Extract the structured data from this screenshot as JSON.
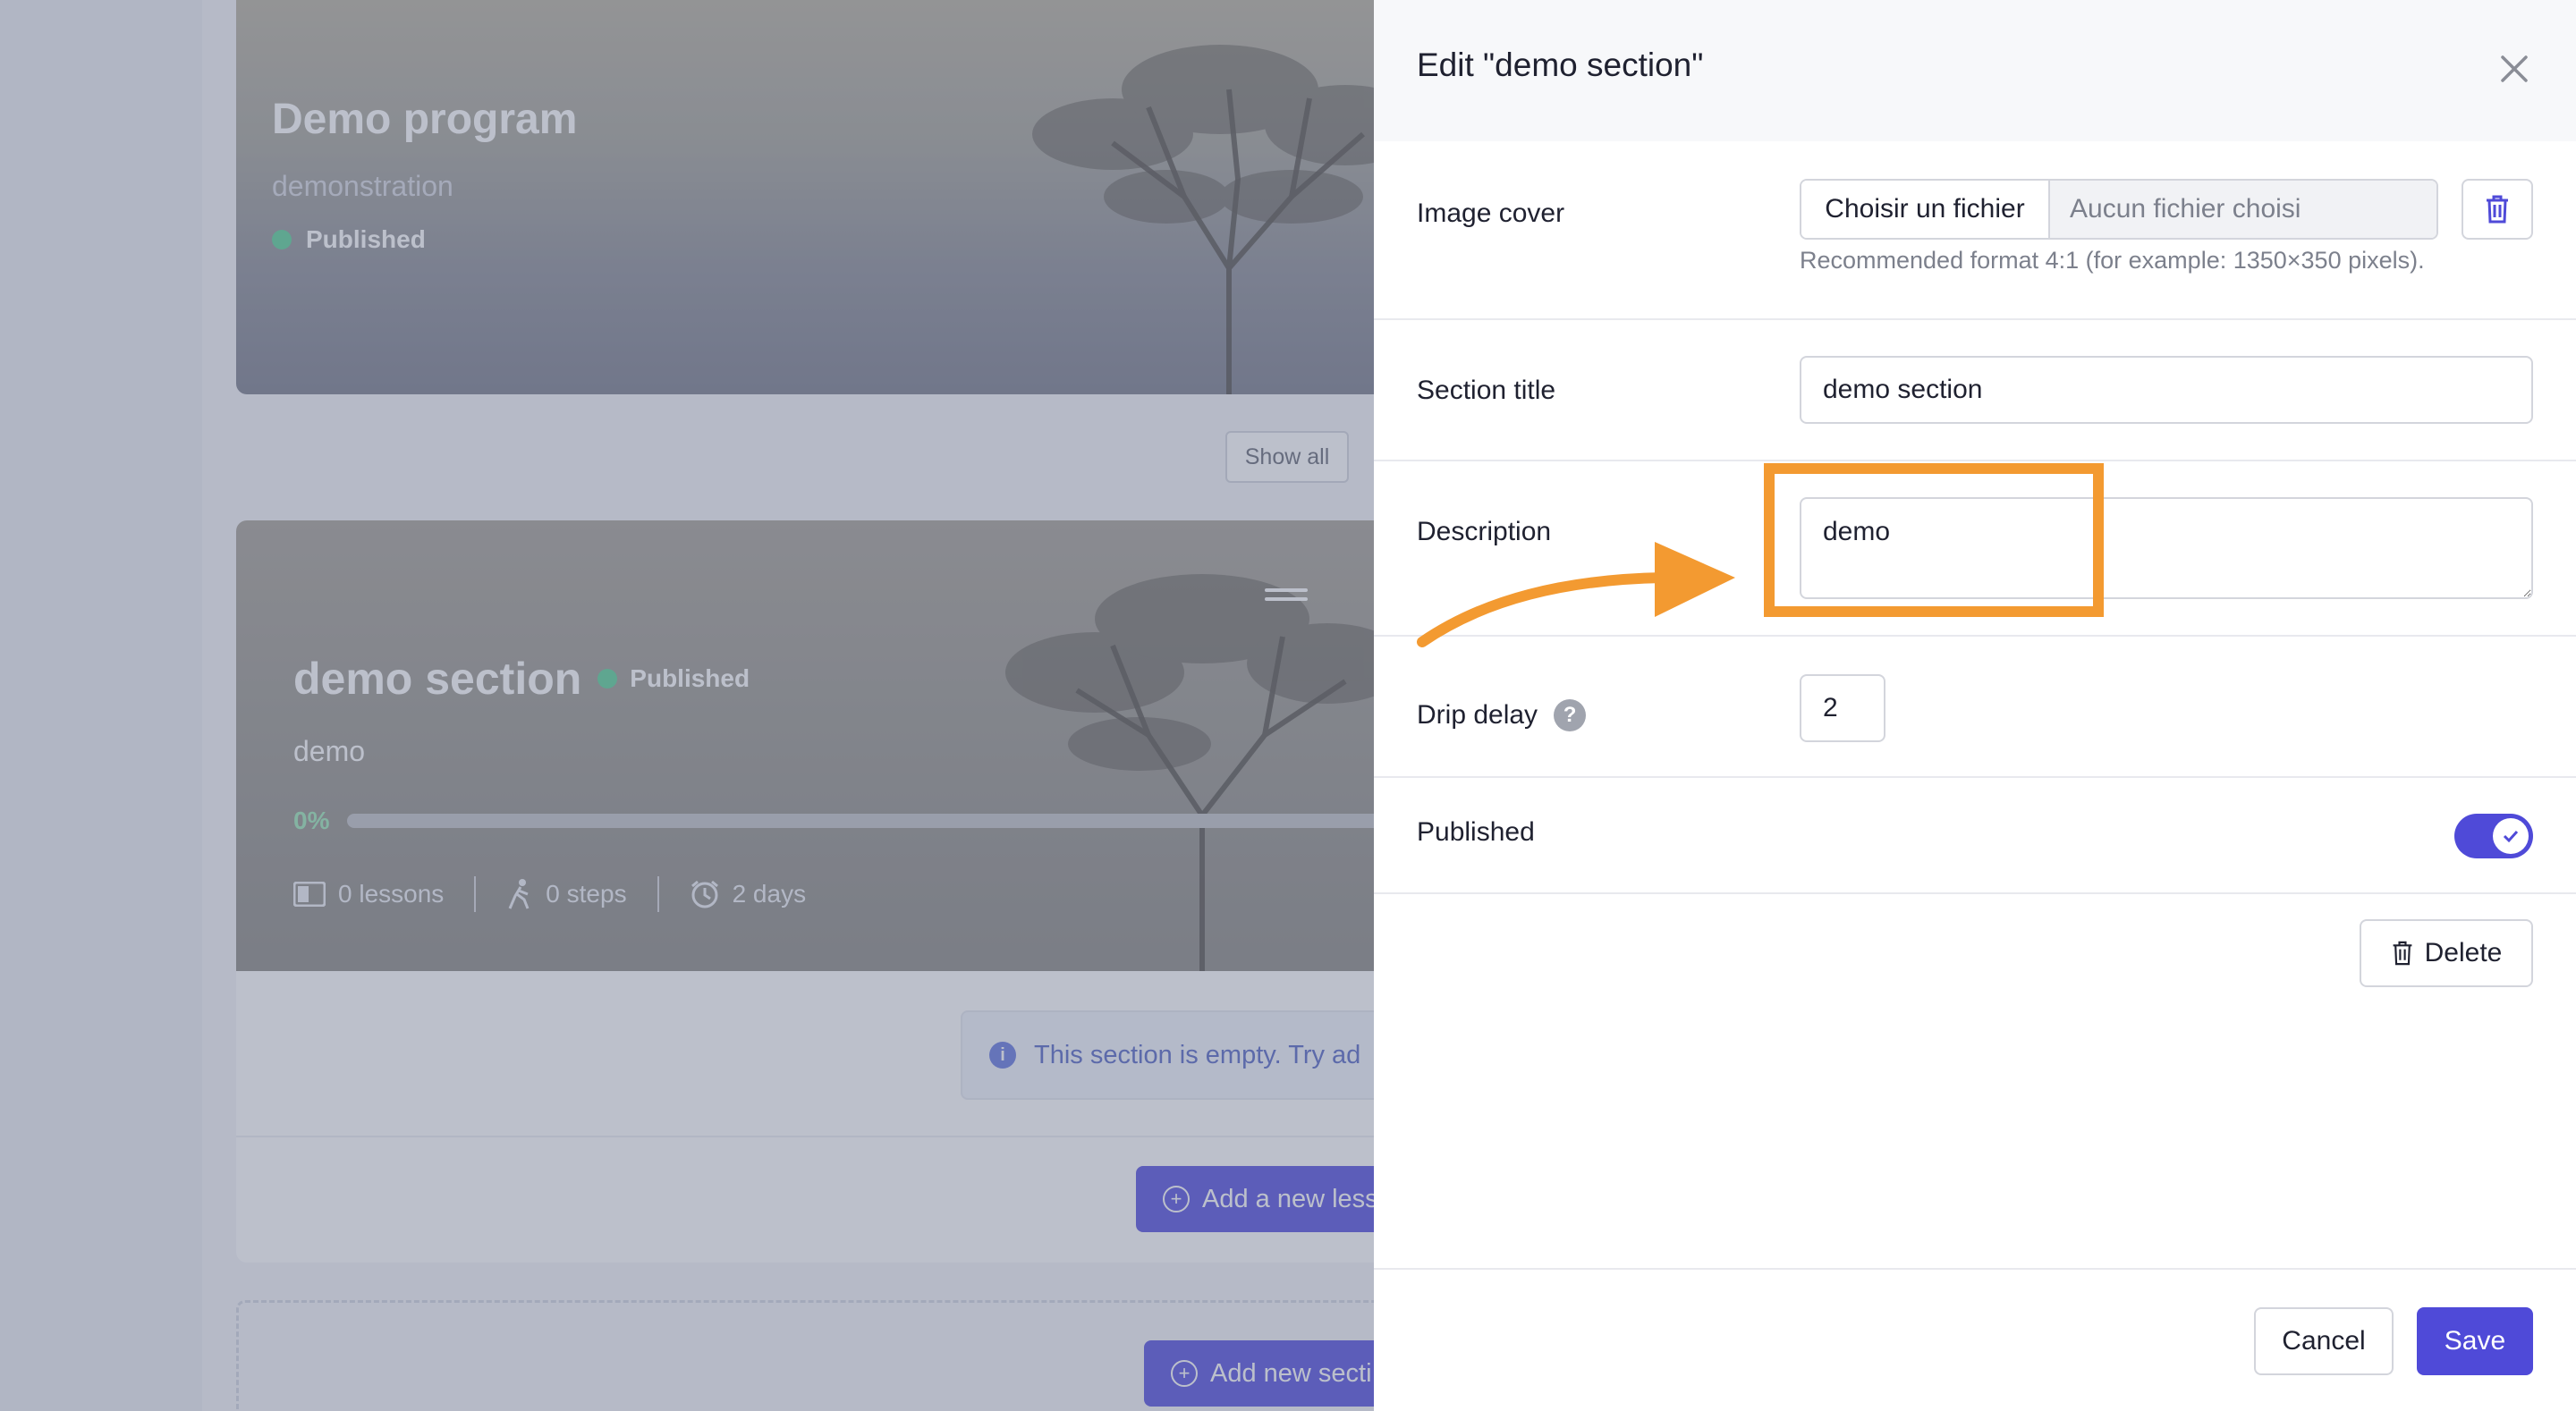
{
  "background": {
    "hero_card": {
      "title": "Demo program",
      "subtitle": "demonstration",
      "status": "Published"
    },
    "show_all_label": "Show all",
    "section_card": {
      "title": "demo section",
      "status": "Published",
      "description": "demo",
      "progress_label": "0%",
      "progress_value": 0,
      "lessons": "0 lessons",
      "steps": "0 steps",
      "days": "2 days"
    },
    "empty_message": "This section is empty. Try ad",
    "add_lesson_label": "Add a new less",
    "add_section_label": "Add new secti"
  },
  "drawer": {
    "title": "Edit \"demo section\"",
    "image_cover": {
      "label": "Image cover",
      "choose_label": "Choisir un fichier",
      "no_file_label": "Aucun fichier choisi",
      "help": "Recommended format 4:1 (for example: 1350×350 pixels)."
    },
    "section_title": {
      "label": "Section title",
      "value": "demo section"
    },
    "description": {
      "label": "Description",
      "value": "demo"
    },
    "drip_delay": {
      "label": "Drip delay",
      "value": "2"
    },
    "published": {
      "label": "Published",
      "value": true
    },
    "delete_label": "Delete",
    "cancel_label": "Cancel",
    "save_label": "Save"
  },
  "colors": {
    "primary": "#4f4ad8",
    "annotation": "#f39a31",
    "status_green": "#5fd39a"
  },
  "icons": [
    "close-icon",
    "trash-icon",
    "question-icon",
    "check-icon",
    "info-icon",
    "plus-circle-icon",
    "lessons-icon",
    "steps-icon",
    "clock-icon",
    "drag-handle-icon"
  ]
}
